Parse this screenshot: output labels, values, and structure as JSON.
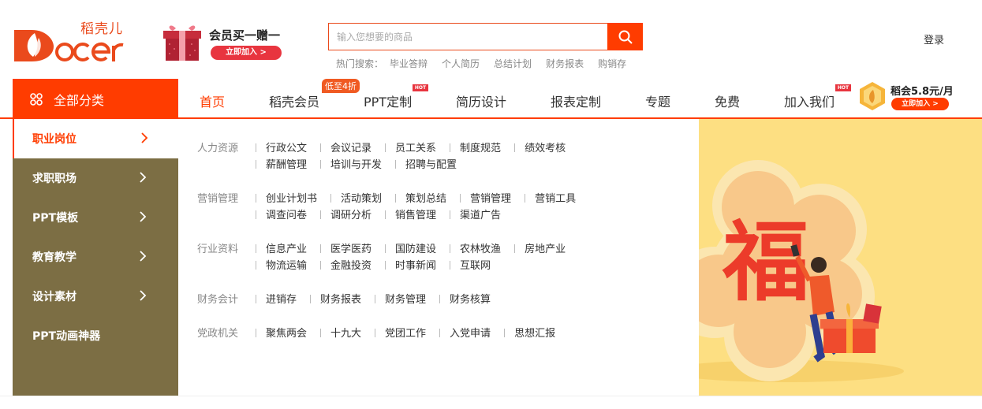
{
  "header": {
    "logo_cn": "稻壳儿",
    "logo_en": "Docer",
    "promo_title": "会员买一赠一",
    "promo_button": "立即加入 >",
    "search_placeholder": "输入您想要的商品",
    "hot_label": "热门搜索：",
    "hot_terms": [
      "毕业答辩",
      "个人简历",
      "总结计划",
      "财务报表",
      "购销存"
    ],
    "login": "登录"
  },
  "nav": {
    "all_categories": "全部分类",
    "items": [
      "首页",
      "稻壳会员",
      "PPT定制",
      "简历设计",
      "报表定制",
      "专题",
      "免费",
      "加入我们"
    ],
    "tag_low": "低至4折",
    "tag_hot": "HOT",
    "vip_text": "稻会5.8元/月",
    "vip_button": "立即加入 >"
  },
  "sidebar": {
    "items": [
      "职业岗位",
      "求职职场",
      "PPT模板",
      "教育教学",
      "设计素材",
      "PPT动画神器"
    ]
  },
  "panel": {
    "groups": [
      {
        "name": "人力资源",
        "rows": [
          [
            "行政公文",
            "会议记录",
            "员工关系",
            "制度规范",
            "绩效考核"
          ],
          [
            "薪酬管理",
            "培训与开发",
            "招聘与配置"
          ]
        ]
      },
      {
        "name": "营销管理",
        "rows": [
          [
            "创业计划书",
            "活动策划",
            "策划总结",
            "营销管理",
            "营销工具"
          ],
          [
            "调查问卷",
            "调研分析",
            "销售管理",
            "渠道广告"
          ]
        ]
      },
      {
        "name": "行业资料",
        "rows": [
          [
            "信息产业",
            "医学医药",
            "国防建设",
            "农林牧渔",
            "房地产业"
          ],
          [
            "物流运输",
            "金融投资",
            "时事新闻",
            "互联网"
          ]
        ]
      },
      {
        "name": "财务会计",
        "rows": [
          [
            "进销存",
            "财务报表",
            "财务管理",
            "财务核算"
          ]
        ]
      },
      {
        "name": "党政机关",
        "rows": [
          [
            "聚焦两会",
            "十九大",
            "党团工作",
            "入党申请",
            "思想汇报"
          ]
        ]
      }
    ]
  },
  "banner": {
    "glyph": "福"
  },
  "colors": {
    "accent": "#ff3c00",
    "sidebar_bg": "#7c6e44",
    "banner_bg": "#fddf82"
  }
}
